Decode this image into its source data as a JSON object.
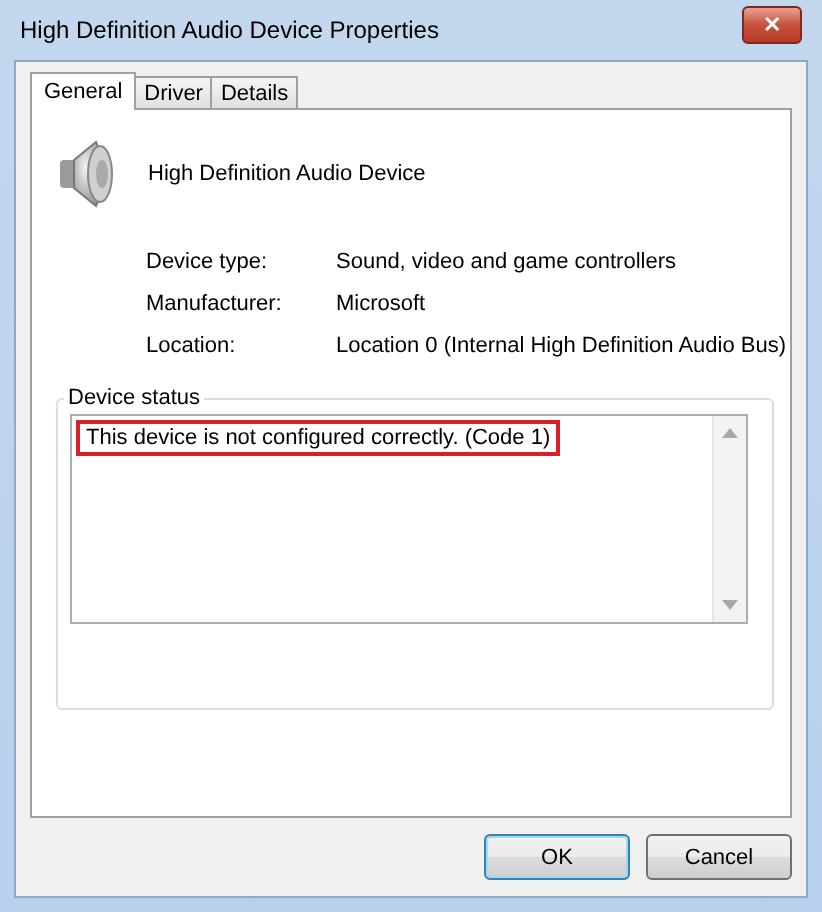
{
  "window": {
    "title": "High Definition Audio Device Properties",
    "close": "✕"
  },
  "tabs": [
    {
      "label": "General",
      "selected": true
    },
    {
      "label": "Driver",
      "selected": false
    },
    {
      "label": "Details",
      "selected": false
    }
  ],
  "device": {
    "name": "High Definition Audio Device"
  },
  "properties": [
    {
      "label": "Device type:",
      "value": "Sound, video and game controllers"
    },
    {
      "label": "Manufacturer:",
      "value": "Microsoft"
    },
    {
      "label": "Location:",
      "value": "Location 0 (Internal High Definition Audio Bus)"
    }
  ],
  "device_status": {
    "title": "Device status",
    "text": "This device is not configured correctly. (Code 1)",
    "highlighted": true
  },
  "buttons": [
    {
      "label": "OK",
      "default": true
    },
    {
      "label": "Cancel",
      "default": false
    }
  ]
}
